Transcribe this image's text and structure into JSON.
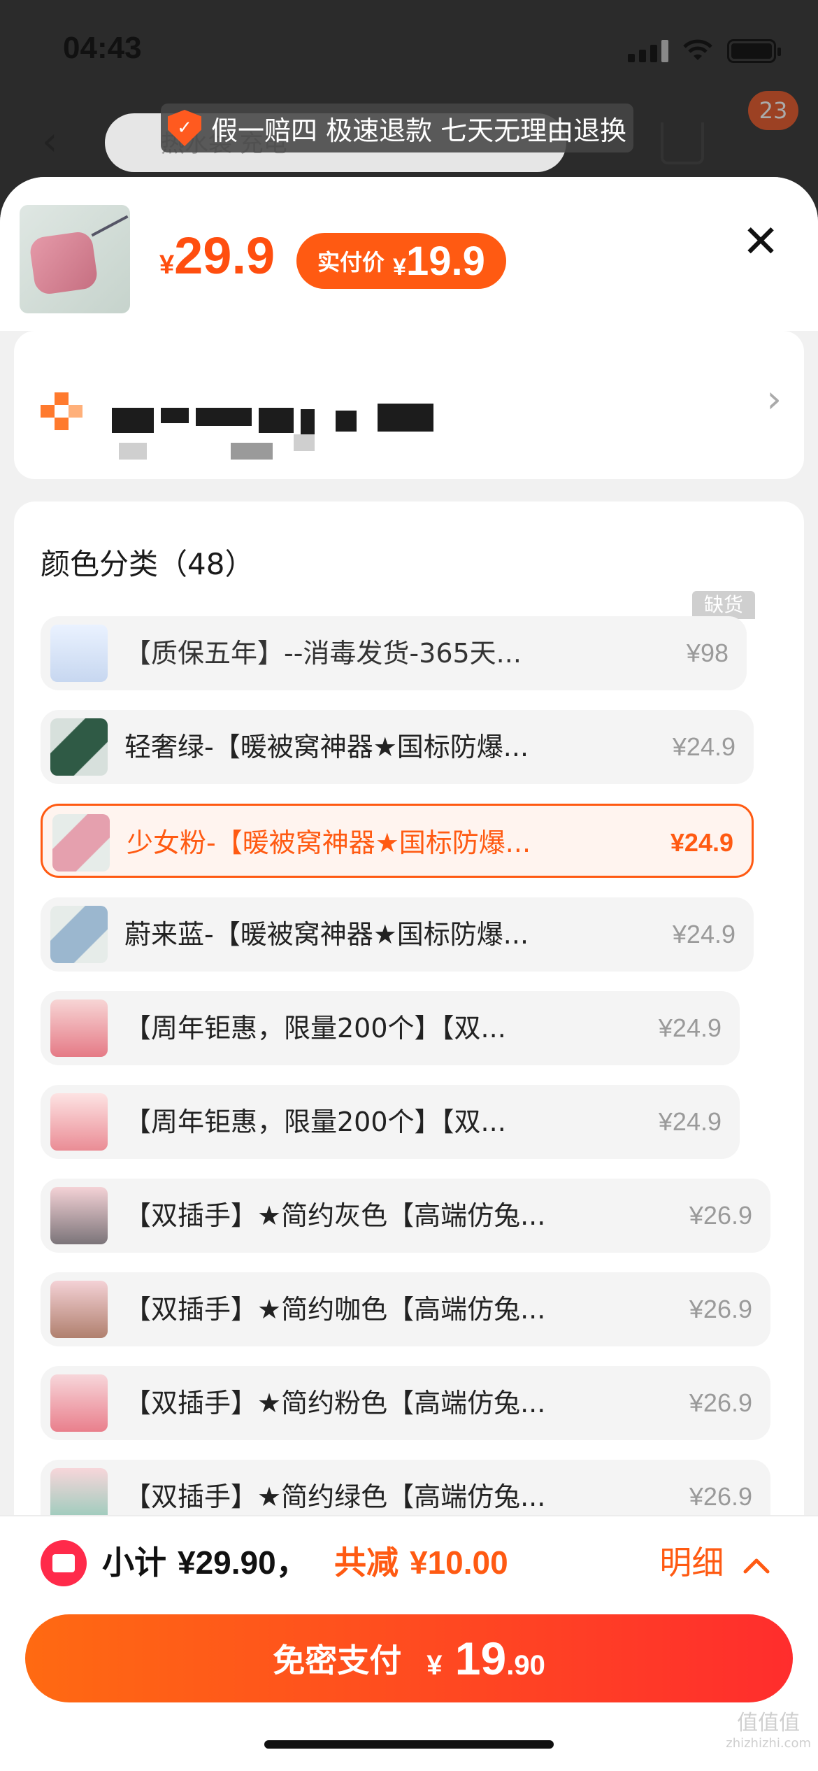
{
  "status_bar": {
    "time": "04:43"
  },
  "nav": {
    "search_placeholder": "热水袋 充电",
    "guarantee_text": "假一赔四 极速退款 七天无理由退换",
    "cart_badge": "23"
  },
  "sheet": {
    "price_currency": "¥",
    "price_value": "29.9",
    "paid_label": "实付价",
    "paid_currency": "¥",
    "paid_value": "19.9",
    "close_icon": "close-icon"
  },
  "options": {
    "title": "颜色分类（48）",
    "out_of_stock_label": "缺货",
    "items": [
      {
        "label": "【质保五年】--消毒发货-365天...",
        "price": "¥98"
      },
      {
        "label": "轻奢绿-【暖被窝神器★国标防爆...",
        "price": "¥24.9"
      },
      {
        "label": "少女粉-【暖被窝神器★国标防爆...",
        "price": "¥24.9"
      },
      {
        "label": "蔚来蓝-【暖被窝神器★国标防爆...",
        "price": "¥24.9"
      },
      {
        "label": "【周年钜惠，限量200个】【双...",
        "price": "¥24.9"
      },
      {
        "label": "【周年钜惠，限量200个】【双...",
        "price": "¥24.9"
      },
      {
        "label": "【双插手】★简约灰色【高端仿兔...",
        "price": "¥26.9"
      },
      {
        "label": "【双插手】★简约咖色【高端仿兔...",
        "price": "¥26.9"
      },
      {
        "label": "【双插手】★简约粉色【高端仿兔...",
        "price": "¥26.9"
      },
      {
        "label": "【双插手】★简约绿色【高端仿兔...",
        "price": "¥26.9"
      }
    ]
  },
  "footer": {
    "subtotal_label": "小计",
    "subtotal_amount": "¥29.90，",
    "discount_label": "共减",
    "discount_amount": "¥10.00",
    "detail_label": "明细",
    "pay_label": "免密支付",
    "pay_currency": "¥",
    "pay_int": "19",
    "pay_dec": ".90"
  },
  "watermark": {
    "main": "值值值",
    "sub": "zhizhizhi.com"
  },
  "colors": {
    "accent": "#ff5a12",
    "selected_bg": "#fff4ef",
    "pay_gradient_start": "#ff6a12",
    "pay_gradient_end": "#ff2d2d"
  }
}
